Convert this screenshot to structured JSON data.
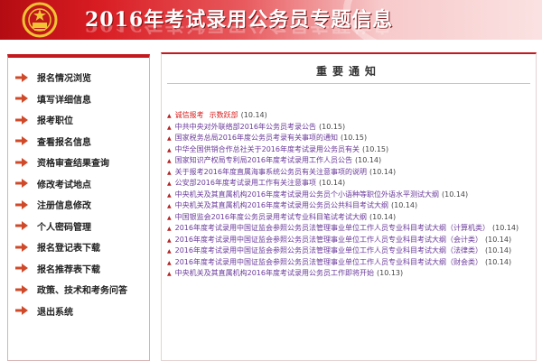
{
  "banner": {
    "title": "2016年考试录用公务员专题信息"
  },
  "menu": [
    "报名情况浏览",
    "填写详细信息",
    "报考职位",
    "查看报名信息",
    "资格审查结果查询",
    "修改考试地点",
    "注册信息修改",
    "个人密码管理",
    "报名登记表下载",
    "报名推荐表下载",
    "政策、技术和考务问答",
    "退出系统"
  ],
  "main": {
    "heading": "重要通知",
    "notices": [
      {
        "title": "诚信报考",
        "title2": "示数跃部",
        "date": "(10.14)"
      },
      {
        "title": "中共中央对外联络部2016年公务员考录公告",
        "date": "(10.15)"
      },
      {
        "title": "国家税务总局2016年度公务员考录有关事项的通知",
        "date": "(10.15)"
      },
      {
        "title": "中华全国供销合作总社关于2016年度考试录用公务员有关",
        "date": "(10.15)"
      },
      {
        "title": "国家知识产权局专利局2016年度考试录用工作人员公告",
        "date": "(10.14)"
      },
      {
        "title": "关于报考2016年度直属海事系统公务员有关注意事项的说明",
        "date": "(10.14)"
      },
      {
        "title": "公安部2016年度考试录用工作有关注意事项",
        "date": "(10.14)"
      },
      {
        "title": "中央机关及其直属机构2016年度考试录用公务员个小语种等职位外语水平测试大纲",
        "date": "(10.14)"
      },
      {
        "title": "中央机关及其直属机构2016年度考试录用公务员公共科目考试大纲",
        "date": "(10.14)"
      },
      {
        "title": "中国银监会2016年度公务员录用考试专业科目笔试考试大纲",
        "date": "(10.14)"
      },
      {
        "title": "2016年度考试录用中国证监会参照公务员法管理事业单位工作人员专业科目考试大纲（计算机类）",
        "date": "(10.14)"
      },
      {
        "title": "2016年度考试录用中国证监会参照公务员法管理事业单位工作人员专业科目考试大纲（会计类）",
        "date": "(10.14)"
      },
      {
        "title": "2016年度考试录用中国证监会参照公务员法管理事业单位工作人员专业科目考试大纲（法律类）",
        "date": "(10.14)"
      },
      {
        "title": "2016年度考试录用中国证监会参照公务员法管理事业单位工作人员专业科目考试大纲（财会类）",
        "date": "(10.14)"
      },
      {
        "title": "中央机关及其直属机构2016年度考试录用公务员工作即将开始",
        "date": "(10.13)"
      }
    ]
  },
  "colors": {
    "brand_red": "#c21a1f",
    "link_purple": "#6a3a9a"
  },
  "icons": {
    "emblem": "national-emblem-icon",
    "menu_bullet": "arrow-right-icon",
    "notice_bullet": "triangle-bullet-icon"
  }
}
